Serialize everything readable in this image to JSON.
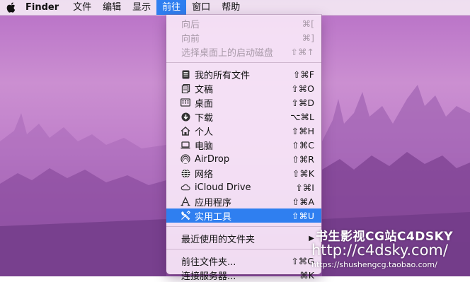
{
  "menubar": {
    "app_name": "Finder",
    "items": [
      "文件",
      "编辑",
      "显示",
      "前往",
      "窗口",
      "帮助"
    ]
  },
  "go_menu": {
    "history": [
      {
        "label": "向后",
        "shortcut": "⌘[",
        "enabled": false
      },
      {
        "label": "向前",
        "shortcut": "⌘]",
        "enabled": false
      },
      {
        "label": "选择桌面上的启动磁盘",
        "shortcut": "⇧⌘↑",
        "enabled": false
      }
    ],
    "places": [
      {
        "label": "我的所有文件",
        "shortcut": "⇧⌘F",
        "icon": "all-files-icon"
      },
      {
        "label": "文稿",
        "shortcut": "⇧⌘O",
        "icon": "documents-icon"
      },
      {
        "label": "桌面",
        "shortcut": "⇧⌘D",
        "icon": "desktop-icon"
      },
      {
        "label": "下载",
        "shortcut": "⌥⌘L",
        "icon": "downloads-icon"
      },
      {
        "label": "个人",
        "shortcut": "⇧⌘H",
        "icon": "home-icon"
      },
      {
        "label": "电脑",
        "shortcut": "⇧⌘C",
        "icon": "computer-icon"
      },
      {
        "label": "AirDrop",
        "shortcut": "⇧⌘R",
        "icon": "airdrop-icon"
      },
      {
        "label": "网络",
        "shortcut": "⇧⌘K",
        "icon": "network-icon"
      },
      {
        "label": "iCloud Drive",
        "shortcut": "⇧⌘I",
        "icon": "icloud-icon"
      },
      {
        "label": "应用程序",
        "shortcut": "⇧⌘A",
        "icon": "applications-icon"
      },
      {
        "label": "实用工具",
        "shortcut": "⇧⌘U",
        "icon": "utilities-icon",
        "highlighted": true
      }
    ],
    "recent_folders": {
      "label": "最近使用的文件夹"
    },
    "folder_actions": [
      {
        "label": "前往文件夹...",
        "shortcut": "⇧⌘G"
      },
      {
        "label": "连接服务器...",
        "shortcut": "⌘K"
      }
    ]
  },
  "watermark": {
    "line1": "书生影视CG站C4DSKY",
    "line2": "http://c4dsky.com/",
    "line3": "https://shushengcg.taobao.com/"
  },
  "colors": {
    "accent": "#2f7ff0",
    "desktop_top": "#b76fc6",
    "desktop_bottom": "#8d4ea3"
  }
}
